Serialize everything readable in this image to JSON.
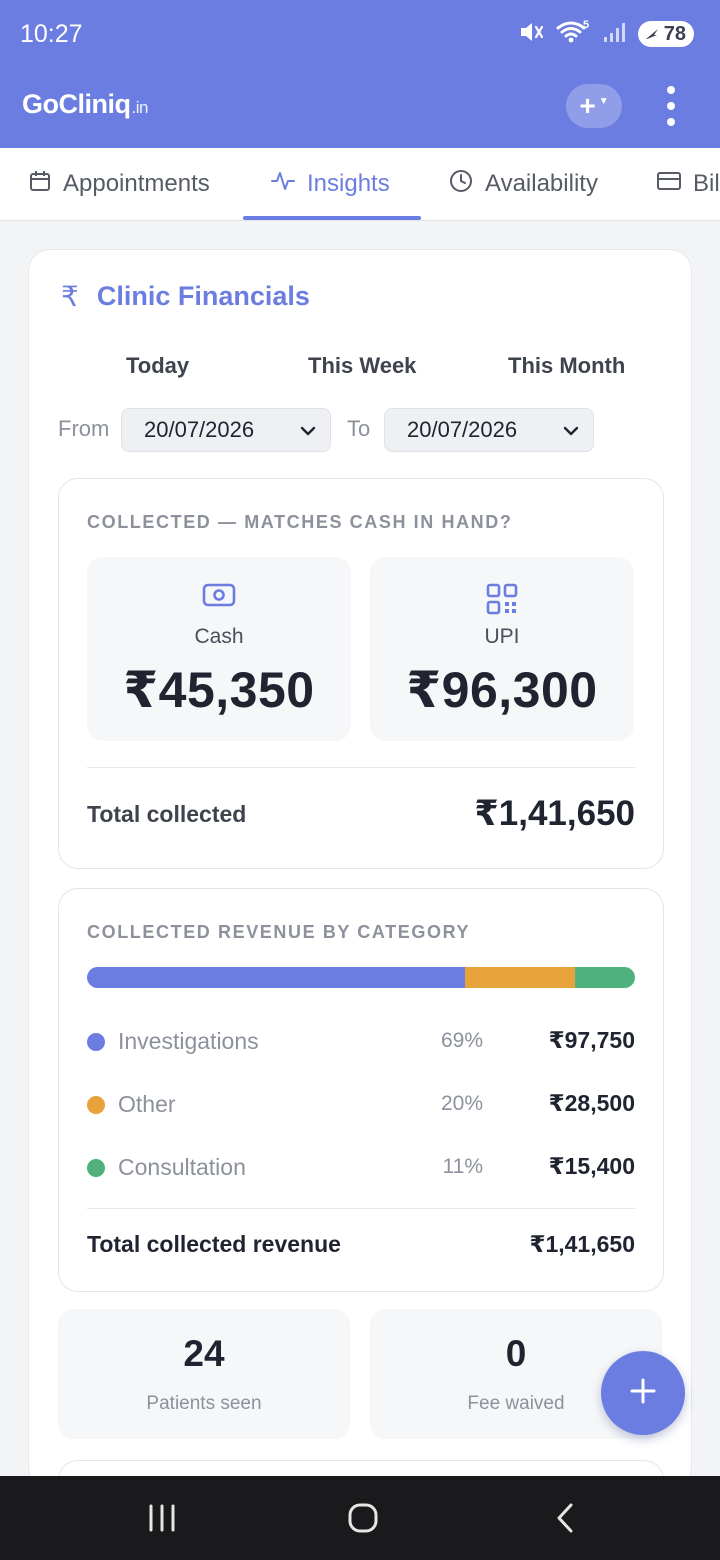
{
  "status_bar": {
    "time": "10:27",
    "battery": "78",
    "signal_badge": "5"
  },
  "header": {
    "brand_name": "GoCliniq",
    "brand_tld": ".in"
  },
  "tabs": [
    {
      "label": "Appointments",
      "icon": "calendar-icon",
      "active": false
    },
    {
      "label": "Insights",
      "icon": "activity-icon",
      "active": true
    },
    {
      "label": "Availability",
      "icon": "clock-icon",
      "active": false
    },
    {
      "label": "Bil",
      "icon": "card-icon",
      "active": false
    }
  ],
  "financials": {
    "title": "Clinic Financials",
    "currency_symbol": "₹",
    "periods": [
      "Today",
      "This Week",
      "This Month"
    ],
    "from_label": "From",
    "to_label": "To",
    "from_date": "20/07/2026",
    "to_date": "20/07/2026"
  },
  "collected": {
    "heading": "COLLECTED — MATCHES CASH IN HAND?",
    "methods": [
      {
        "name": "Cash",
        "amount": "₹45,350",
        "icon": "banknote-icon"
      },
      {
        "name": "UPI",
        "amount": "₹96,300",
        "icon": "qr-code-icon"
      }
    ],
    "total_label": "Total collected",
    "total_value": "₹1,41,650"
  },
  "revenue": {
    "heading": "COLLECTED REVENUE BY CATEGORY",
    "categories": [
      {
        "name": "Investigations",
        "percent": "69%",
        "share": 69,
        "amount": "₹97,750",
        "color": "#6b7de0"
      },
      {
        "name": "Other",
        "percent": "20%",
        "share": 20,
        "amount": "₹28,500",
        "color": "#e8a23c"
      },
      {
        "name": "Consultation",
        "percent": "11%",
        "share": 11,
        "amount": "₹15,400",
        "color": "#4fb27c"
      }
    ],
    "total_label": "Total collected revenue",
    "total_value": "₹1,41,650"
  },
  "stats": [
    {
      "value": "24",
      "label": "Patients seen"
    },
    {
      "value": "0",
      "label": "Fee waived"
    }
  ],
  "colors": {
    "primary": "#6b7de0",
    "nav_bar": "#1a1a1c"
  }
}
